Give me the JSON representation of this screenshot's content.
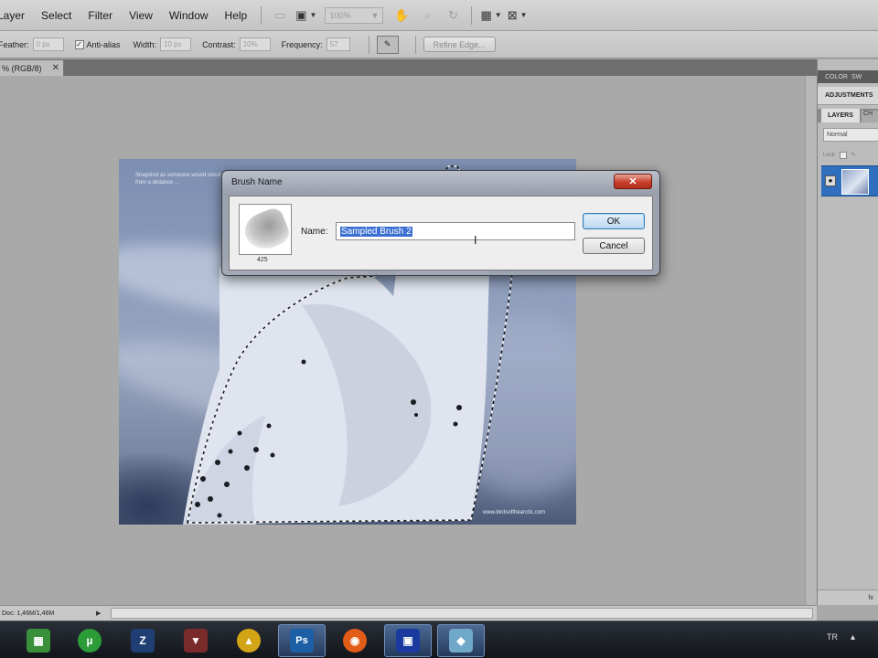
{
  "menubar": {
    "items": [
      "Layer",
      "Select",
      "Filter",
      "View",
      "Window",
      "Help"
    ],
    "zoom_value": "100%"
  },
  "options": {
    "feather_label": "Feather:",
    "feather_value": "0 px",
    "antialias_label": "Anti-alias",
    "width_label": "Width:",
    "width_value": "10 px",
    "contrast_label": "Contrast:",
    "contrast_value": "10%",
    "frequency_label": "Frequency:",
    "frequency_value": "57",
    "refine_label": "Refine Edge..."
  },
  "document": {
    "tab_label": "% (RGB/8)",
    "tagline": "Snapshot as someone would shoot it from a distance ...",
    "url": "www.birdsofthearctic.com"
  },
  "panels": {
    "top_tabs": [
      "COLOR",
      "SW"
    ],
    "adjustments_label": "ADJUSTMENTS",
    "layers_tab": "LAYERS",
    "channels_tab": "CH",
    "blend_mode": "Normal",
    "lock_label": "Lock:",
    "footer_label": "fx"
  },
  "status": {
    "doc_info": "Doc: 1,46M/1,46M"
  },
  "dialog": {
    "title": "Brush Name",
    "size_value": "425",
    "name_label": "Name:",
    "name_value": "Sampled Brush 2",
    "ok_label": "OK",
    "cancel_label": "Cancel"
  },
  "taskbar": {
    "lang": "TR",
    "items": [
      "windows-explorer",
      "utorrent",
      "dreamweaver",
      "game-icon",
      "app-icon",
      "photoshop",
      "firefox",
      "media-app",
      "app-window"
    ]
  },
  "colors": {
    "accent": "#3b6fd1",
    "layer_selected": "#2f6fbe"
  }
}
